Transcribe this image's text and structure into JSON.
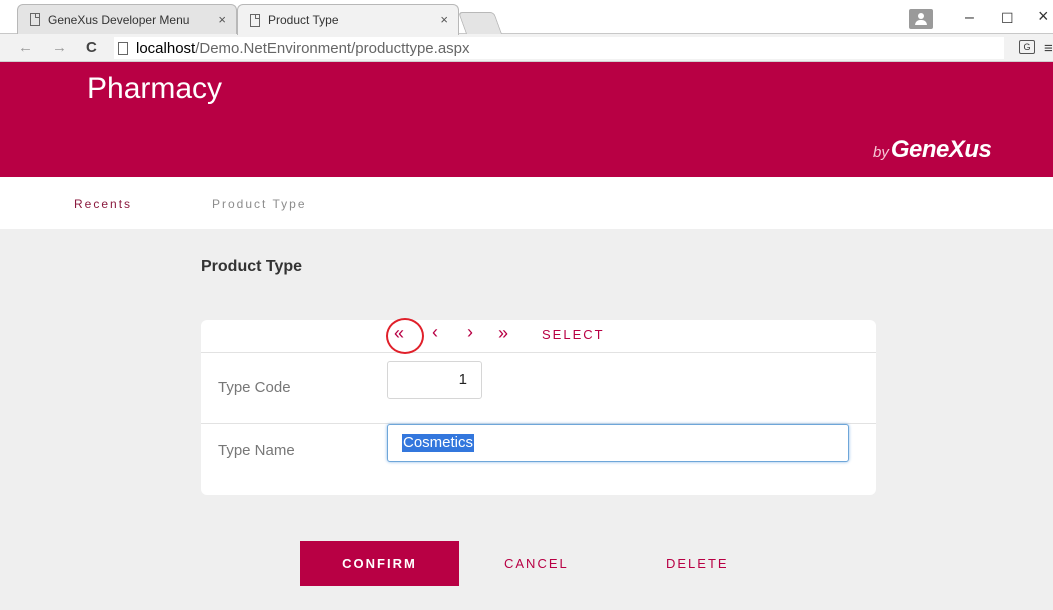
{
  "browser": {
    "tabs": [
      {
        "label": "GeneXus Developer Menu",
        "close": "×"
      },
      {
        "label": "Product Type",
        "close": "×"
      }
    ],
    "window_controls": {
      "minimize": "–",
      "maximize": "☐",
      "close": "×"
    },
    "nav": {
      "back": "←",
      "forward": "→",
      "reload": "C"
    },
    "url": {
      "host": "localhost",
      "path": "/Demo.NetEnvironment/producttype.aspx"
    },
    "translate": "G",
    "menu": "≡"
  },
  "app": {
    "title": "Pharmacy",
    "brand_by": "by",
    "brand_name": "GeneXus",
    "accent_color": "#b80044"
  },
  "navbar": {
    "recents": "Recents",
    "product_type": "Product Type"
  },
  "form": {
    "heading": "Product Type",
    "pager": {
      "first": "«",
      "prev": "‹",
      "next": "›",
      "last": "»",
      "select": "SELECT"
    },
    "type_code": {
      "label": "Type Code",
      "value": "1"
    },
    "type_name": {
      "label": "Type Name",
      "value": "Cosmetics"
    }
  },
  "actions": {
    "confirm": "CONFIRM",
    "cancel": "CANCEL",
    "delete": "DELETE"
  }
}
